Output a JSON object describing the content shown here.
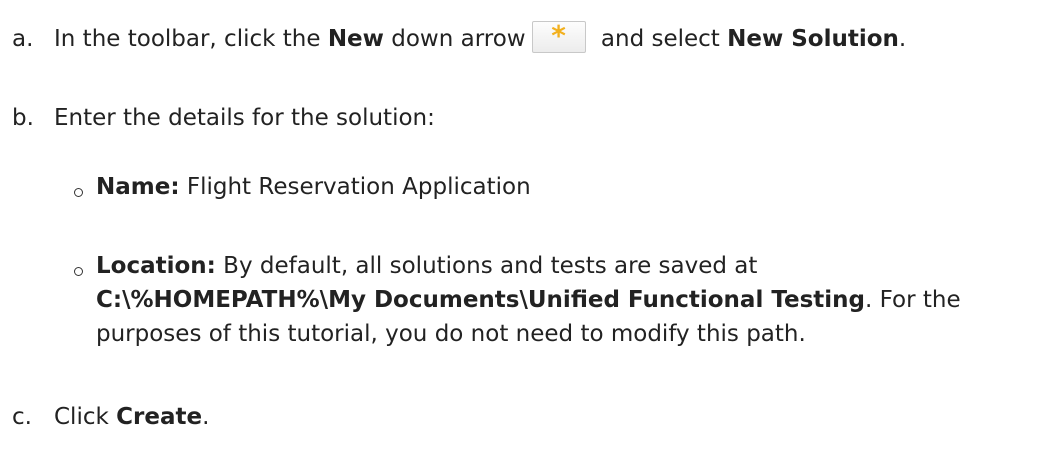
{
  "steps": [
    {
      "marker": "a.",
      "text_1": "In the toolbar, click the ",
      "bold_1": "New",
      "text_2": " down arrow",
      "text_3": " and select ",
      "bold_2": "New Solution",
      "text_4": "."
    },
    {
      "marker": "b.",
      "text": "Enter the details for the solution:",
      "bullets": [
        {
          "label": "Name:",
          "value": " Flight Reservation Application"
        },
        {
          "label": "Location:",
          "line1": " By default, all solutions and tests are saved at",
          "path": "C:\\%HOMEPATH%\\My Documents\\Unified Functional Testing",
          "line2_after": ". For the",
          "line3": "purposes of this tutorial, you do not need to modify this path."
        }
      ]
    },
    {
      "marker": "c.",
      "text_1": "Click ",
      "bold_1": "Create",
      "text_2": "."
    }
  ],
  "toolbar_icon": {
    "glyph": "*",
    "icon": "new-asterisk-icon",
    "color": "#f2b01e"
  }
}
